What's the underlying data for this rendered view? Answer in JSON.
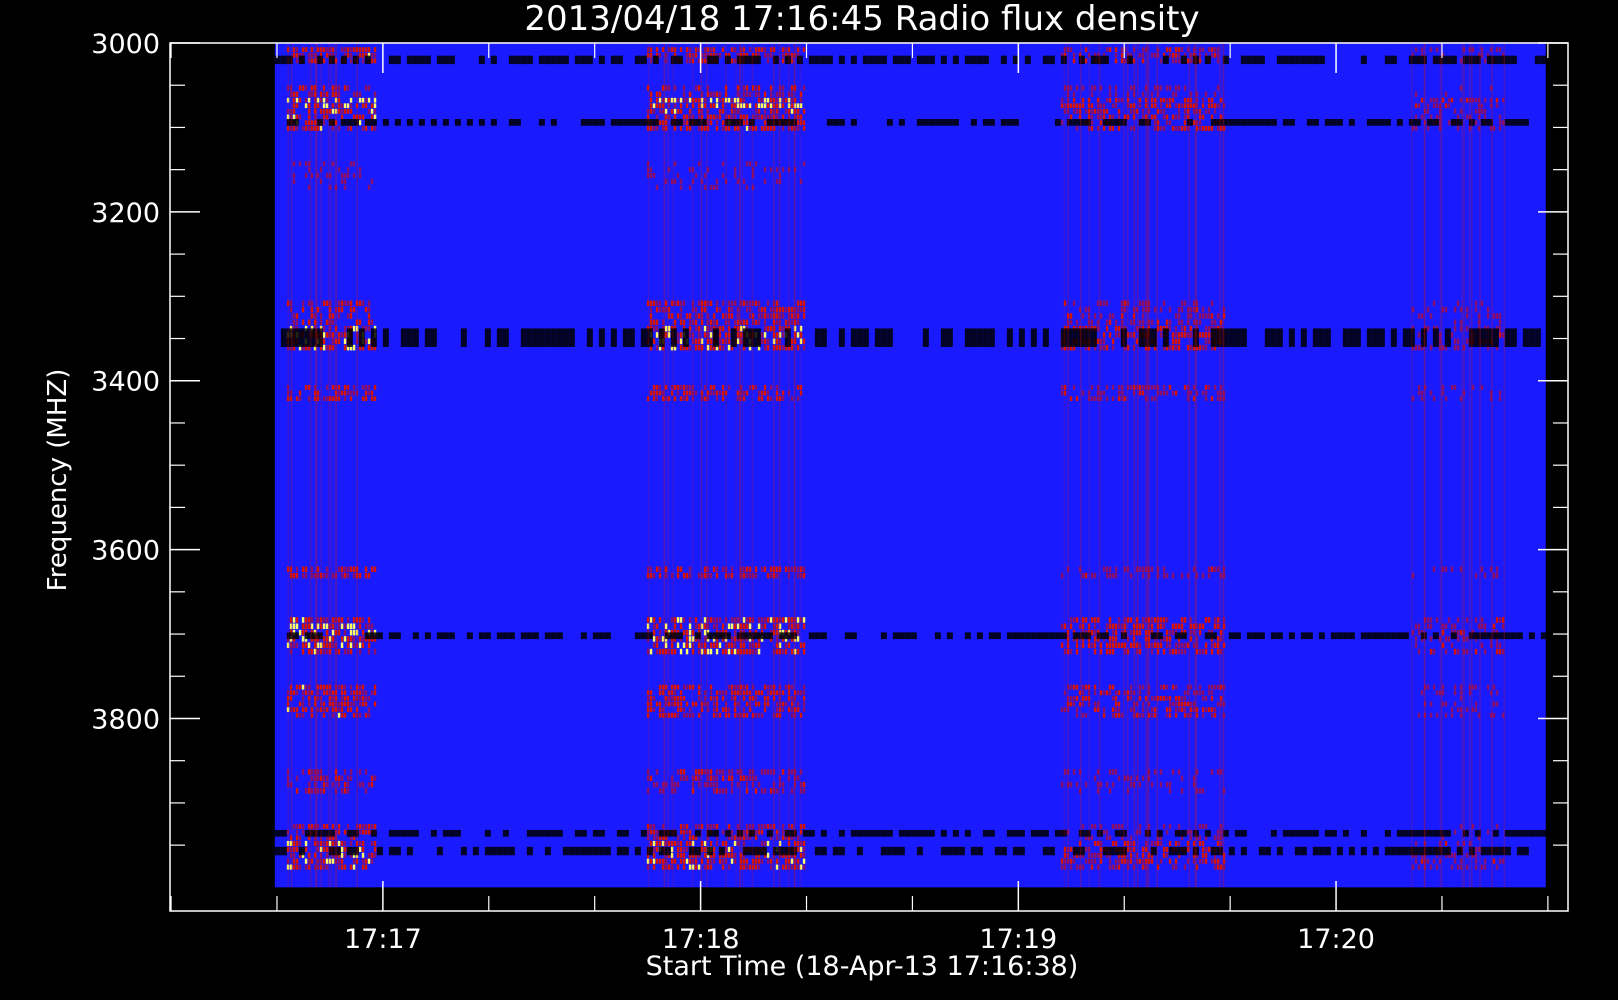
{
  "chart_data": {
    "type": "heatmap",
    "title": "2013/04/18 17:16:45 Radio flux density",
    "xlabel": "Start Time (18-Apr-13 17:16:38)",
    "ylabel": "Frequency (MHZ)",
    "x_tick_labels": [
      "17:17",
      "17:18",
      "17:19",
      "17:20"
    ],
    "x_tick_values_min": [
      0.37,
      1.37,
      2.37,
      3.37
    ],
    "y_tick_labels": [
      "3000",
      "3200",
      "3400",
      "3600",
      "3800"
    ],
    "y_tick_values": [
      3000,
      3200,
      3400,
      3600,
      3800
    ],
    "xlim_min_after_start": [
      -0.3,
      4.1
    ],
    "ylim": [
      3000,
      4028
    ],
    "data_extent": {
      "t_start_min": 0.03,
      "t_end_min": 4.03,
      "f_start": 3000,
      "f_end": 4000
    },
    "colormap": [
      "#000000",
      "#1a1aff",
      "#d81400",
      "#ffff66"
    ],
    "background_level_color": "#1a1aff",
    "emission_bands_mhz": [
      {
        "from": 3005,
        "to": 3025,
        "strength": 0.75
      },
      {
        "from": 3050,
        "to": 3065,
        "strength": 0.55
      },
      {
        "from": 3065,
        "to": 3078,
        "strength": 1.0
      },
      {
        "from": 3078,
        "to": 3105,
        "strength": 0.8
      },
      {
        "from": 3140,
        "to": 3175,
        "strength": 0.35
      },
      {
        "from": 3305,
        "to": 3335,
        "strength": 0.65
      },
      {
        "from": 3335,
        "to": 3365,
        "strength": 0.95
      },
      {
        "from": 3405,
        "to": 3425,
        "strength": 0.7
      },
      {
        "from": 3620,
        "to": 3635,
        "strength": 0.65
      },
      {
        "from": 3680,
        "to": 3725,
        "strength": 0.95
      },
      {
        "from": 3760,
        "to": 3800,
        "strength": 0.75
      },
      {
        "from": 3860,
        "to": 3890,
        "strength": 0.5
      },
      {
        "from": 3925,
        "to": 3945,
        "strength": 0.6
      },
      {
        "from": 3945,
        "to": 3980,
        "strength": 0.9
      }
    ],
    "dark_bands_mhz": [
      {
        "from": 3015,
        "to": 3025
      },
      {
        "from": 3090,
        "to": 3098
      },
      {
        "from": 3338,
        "to": 3360
      },
      {
        "from": 3698,
        "to": 3706
      },
      {
        "from": 3932,
        "to": 3940
      },
      {
        "from": 3952,
        "to": 3962
      }
    ],
    "active_time_intervals_min": [
      {
        "from": 0.06,
        "to": 0.35,
        "strength": 1.0
      },
      {
        "from": 1.2,
        "to": 1.7,
        "strength": 0.95
      },
      {
        "from": 2.5,
        "to": 3.02,
        "strength": 0.7
      },
      {
        "from": 3.6,
        "to": 3.9,
        "strength": 0.5
      }
    ],
    "grid": false,
    "legend": "none"
  }
}
